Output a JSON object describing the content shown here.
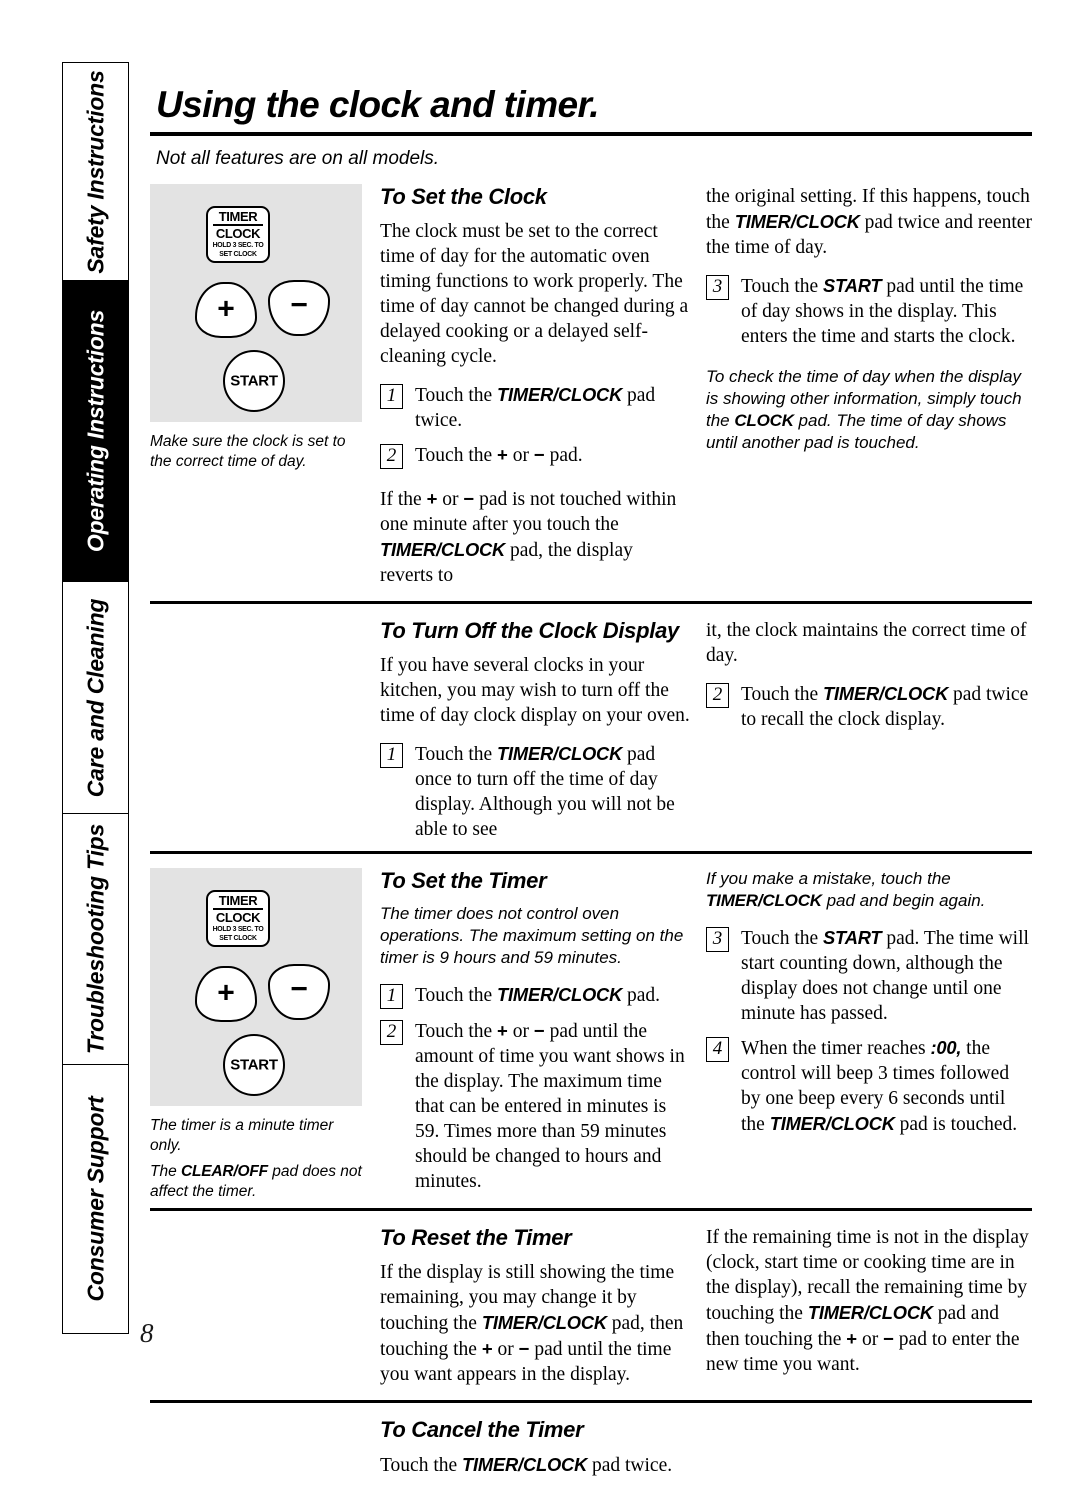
{
  "page": {
    "title": "Using the clock and timer.",
    "subtitle": "Not all features are on all models.",
    "number": "8"
  },
  "sidebar": {
    "tabs": [
      {
        "label": "Safety Instructions",
        "active": false
      },
      {
        "label": "Operating Instructions",
        "active": true
      },
      {
        "label": "Care and Cleaning",
        "active": false
      },
      {
        "label": "Troubleshooting Tips",
        "active": false
      },
      {
        "label": "Consumer Support",
        "active": false
      }
    ]
  },
  "control_panel": {
    "timer_clock_line1": "TIMER",
    "timer_clock_line2": "CLOCK",
    "timer_clock_line3a": "HOLD 3 SEC. TO",
    "timer_clock_line3b": "SET CLOCK",
    "plus_glyph": "+",
    "minus_glyph": "−",
    "start_label": "START"
  },
  "figures": {
    "clock": {
      "caption": "Make sure the clock is set to the correct time of day."
    },
    "timer": {
      "caption_line1": "The timer is a minute timer only.",
      "caption_line2_pre": "The ",
      "caption_line2_pad": "CLEAR/OFF",
      "caption_line2_post": " pad does not affect the timer."
    }
  },
  "sections": {
    "set_clock": {
      "heading": "To Set the Clock",
      "intro": "The clock must be set to the correct time of day for the automatic oven timing functions to work properly. The time of day cannot be changed during a delayed cooking or a delayed self-cleaning cycle.",
      "step1_num": "1",
      "step1_pre": "Touch the ",
      "step1_pad": "TIMER/CLOCK",
      "step1_post": " pad twice.",
      "step2_num": "2",
      "step2_pre": "Touch the ",
      "step2_plus": "+",
      "step2_mid": " or ",
      "step2_minus": "−",
      "step2_post": " pad.",
      "after_pre": "If the ",
      "after_plus": "+",
      "after_mid": " or ",
      "after_minus": "−",
      "after_mid2": " pad is not touched within one minute after you touch the ",
      "after_pad": "TIMER/CLOCK",
      "after_post": " pad, the display reverts to",
      "right_cont_pre": "the original setting. If this happens, touch the ",
      "right_cont_pad": "TIMER/CLOCK",
      "right_cont_post": " pad twice and reenter the time of day.",
      "step3_num": "3",
      "step3_pre": "Touch the ",
      "step3_pad": "START",
      "step3_post": " pad until the time of day shows in the display. This enters the time and starts the clock.",
      "note_pre": "To check the time of day when the display is showing other information, simply touch the ",
      "note_pad": "CLOCK",
      "note_post": " pad. The time of day shows until another pad is touched."
    },
    "turn_off_display": {
      "heading": "To Turn Off the Clock Display",
      "intro": "If you have several clocks in your kitchen, you may wish to turn off the time of day clock display on your oven.",
      "step1_num": "1",
      "step1_pre": "Touch the ",
      "step1_pad": "TIMER/CLOCK",
      "step1_post": " pad once to turn off the time of day display. Although you will not be able to see",
      "right_cont": "it, the clock maintains the correct time of day.",
      "step2_num": "2",
      "step2_pre": "Touch the ",
      "step2_pad": "TIMER/CLOCK",
      "step2_post": " pad twice to recall the clock display."
    },
    "set_timer": {
      "heading": "To Set the Timer",
      "note": "The timer does not control oven operations. The maximum setting on the timer is 9 hours and 59 minutes.",
      "step1_num": "1",
      "step1_pre": "Touch the ",
      "step1_pad": "TIMER/CLOCK",
      "step1_post": " pad.",
      "step2_num": "2",
      "step2_pre": "Touch the ",
      "step2_plus": "+",
      "step2_mid": " or ",
      "step2_minus": "−",
      "step2_post": " pad until the amount of time you want shows in the display. The maximum time that can be entered in minutes is 59. Times more than 59 minutes should be changed to hours and minutes.",
      "right_note_pre": "If you make a mistake, touch the ",
      "right_note_pad": "TIMER/CLOCK",
      "right_note_post": " pad and begin again.",
      "step3_num": "3",
      "step3_pre": "Touch the ",
      "step3_pad": "START",
      "step3_post": " pad. The time will start counting down, although the display does not change until one minute has passed.",
      "step4_num": "4",
      "step4_pre": "When the timer reaches ",
      "step4_value": ":00,",
      "step4_mid": " the control will beep 3 times followed by one beep every 6 seconds until the ",
      "step4_pad": "TIMER/CLOCK",
      "step4_post": " pad is touched."
    },
    "reset_timer": {
      "heading": "To Reset the Timer",
      "left_pre": "If the display is still showing the time remaining, you may change it by touching the ",
      "left_pad": "TIMER/CLOCK",
      "left_mid": " pad, then touching the ",
      "left_plus": "+",
      "left_mid2": " or ",
      "left_minus": "−",
      "left_post": " pad until the time you want appears in the display.",
      "right_pre": "If the remaining time is not in the display (clock, start time or cooking time are in the display), recall the remaining time by touching the ",
      "right_pad": "TIMER/CLOCK",
      "right_mid": " pad and then touching the ",
      "right_plus": "+",
      "right_mid2": " or ",
      "right_minus": "−",
      "right_post": " pad to enter the new time you want."
    },
    "cancel_timer": {
      "heading": "To Cancel the Timer",
      "text_pre": "Touch the ",
      "text_pad": "TIMER/CLOCK",
      "text_post": " pad twice."
    }
  }
}
